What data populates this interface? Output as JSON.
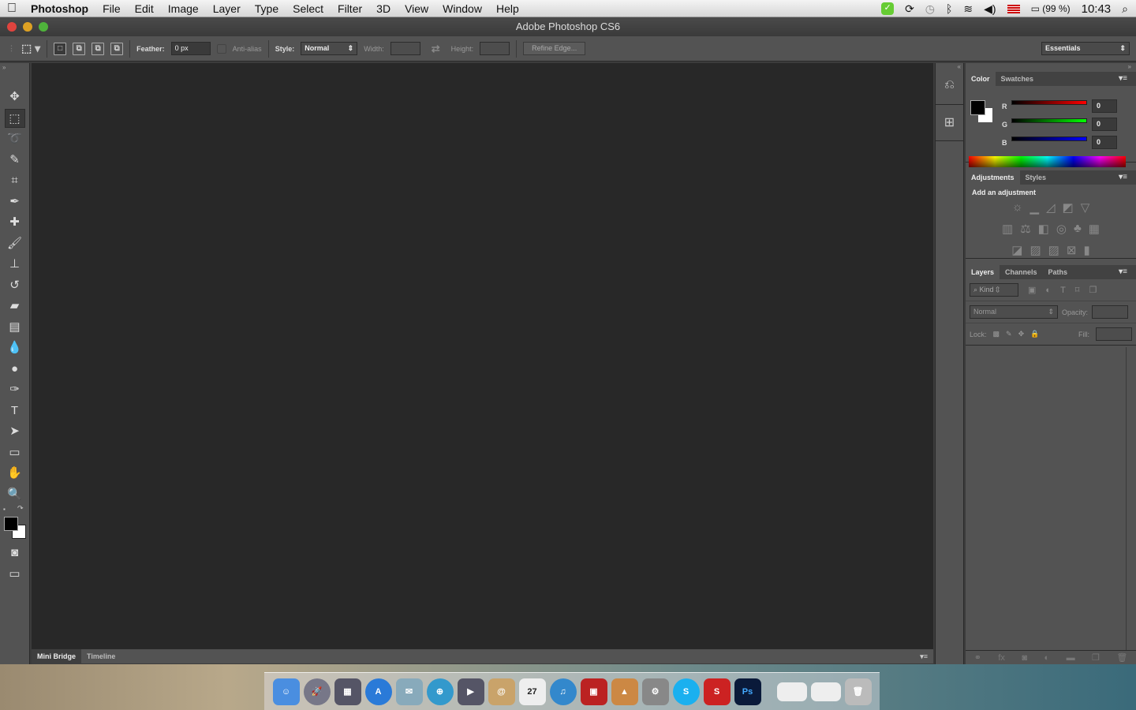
{
  "menubar": {
    "app": "Photoshop",
    "items": [
      "File",
      "Edit",
      "Image",
      "Layer",
      "Type",
      "Select",
      "Filter",
      "3D",
      "View",
      "Window",
      "Help"
    ],
    "battery": "(99 %)",
    "time": "10:43"
  },
  "window": {
    "title": "Adobe Photoshop CS6"
  },
  "options": {
    "feather_label": "Feather:",
    "feather_value": "0 px",
    "antialias": "Anti-alias",
    "style_label": "Style:",
    "style_value": "Normal",
    "width_label": "Width:",
    "height_label": "Height:",
    "refine": "Refine Edge...",
    "workspace": "Essentials"
  },
  "bottom_tabs": [
    "Mini Bridge",
    "Timeline"
  ],
  "color_panel": {
    "tabs": [
      "Color",
      "Swatches"
    ],
    "r_label": "R",
    "g_label": "G",
    "b_label": "B",
    "r": "0",
    "g": "0",
    "b": "0"
  },
  "adjustments_panel": {
    "tabs": [
      "Adjustments",
      "Styles"
    ],
    "heading": "Add an adjustment"
  },
  "layers_panel": {
    "tabs": [
      "Layers",
      "Channels",
      "Paths"
    ],
    "kind": "Kind",
    "blend": "Normal",
    "opacity_label": "Opacity:",
    "lock_label": "Lock:",
    "fill_label": "Fill:"
  },
  "colors": {
    "accent_red": "#ff0000",
    "accent_green": "#00ff00",
    "accent_blue": "#0000ff"
  }
}
